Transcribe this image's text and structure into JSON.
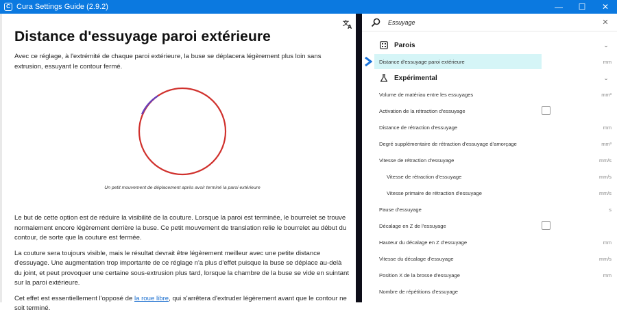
{
  "window": {
    "title": "Cura Settings Guide (2.9.2)",
    "minimize": "—",
    "maximize": "☐",
    "close": "✕"
  },
  "article": {
    "heading": "Distance d'essuyage paroi extérieure",
    "intro": "Avec ce réglage, à l'extrémité de chaque paroi extérieure, la buse se déplacera légèrement plus loin sans extrusion, essuyant le contour fermé.",
    "caption": "Un petit mouvement de déplacement après avoir terminé la paroi extérieure",
    "para2": "Le but de cette option est de réduire la visibilité de la couture. Lorsque la paroi est terminée, le bourrelet se trouve normalement encore légèrement derrière la buse. Ce petit mouvement de translation relie le bourrelet au début du contour, de sorte que la couture est fermée.",
    "para3": "La couture sera toujours visible, mais le résultat devrait être légèrement meilleur avec une petite distance d'essuyage. Une augmentation trop importante de ce réglage n'a plus d'effet puisque la buse se déplace au-delà du joint, et peut provoquer une certaine sous-extrusion plus tard, lorsque la chambre de la buse se vide en suintant sur la paroi extérieure.",
    "para4_before": "Cet effet est essentiellement l'opposé de ",
    "para4_link": "la roue libre",
    "para4_after": ", qui s'arrêtera d'extruder légèrement avant que le contour ne soit terminé."
  },
  "search": {
    "value": "Essuyage",
    "clear": "✕"
  },
  "categories": {
    "walls": {
      "label": "Parois",
      "chevron": "⌄"
    },
    "experimental": {
      "label": "Expérimental",
      "chevron": "⌄"
    }
  },
  "settings": [
    {
      "label": "Distance d'essuyage paroi extérieure",
      "unit": "mm"
    },
    {
      "label": "Volume de matériau entre les essuyages",
      "unit": "mm³"
    },
    {
      "label": "Activation de la rétraction d'essuyage",
      "unit": ""
    },
    {
      "label": "Distance de rétraction d'essuyage",
      "unit": "mm"
    },
    {
      "label": "Degré supplémentaire de rétraction d'essuyage d'amorçage",
      "unit": "mm³"
    },
    {
      "label": "Vitesse de rétraction d'essuyage",
      "unit": "mm/s"
    },
    {
      "label": "Vitesse de rétraction d'essuyage",
      "unit": "mm/s"
    },
    {
      "label": "Vitesse primaire de rétraction d'essuyage",
      "unit": "mm/s"
    },
    {
      "label": "Pause d'essuyage",
      "unit": "s"
    },
    {
      "label": "Décalage en Z de l'essuyage",
      "unit": ""
    },
    {
      "label": "Hauteur du décalage en Z d'essuyage",
      "unit": "mm"
    },
    {
      "label": "Vitesse du décalage d'essuyage",
      "unit": "mm/s"
    },
    {
      "label": "Position X de la brosse d'essuyage",
      "unit": "mm"
    },
    {
      "label": "Nombre de répétitions d'essuyage",
      "unit": ""
    }
  ],
  "colors": {
    "titlebar": "#0b79e0",
    "highlight": "#d5f5f7",
    "selection_arrow": "#1a73d9",
    "circle": "#d0312d",
    "wipe": "#6a3fb8"
  }
}
